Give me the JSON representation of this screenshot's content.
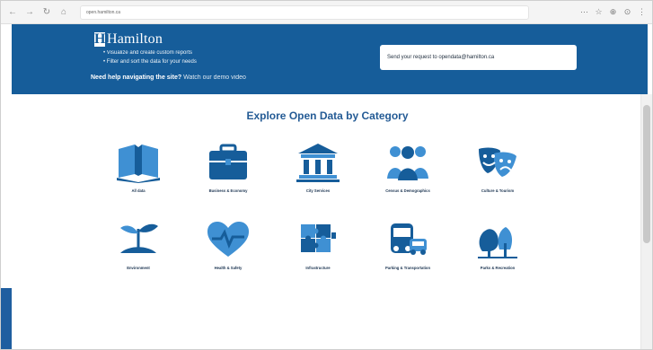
{
  "browser": {
    "url": "open.hamilton.ca"
  },
  "hero": {
    "logo": "Hamilton",
    "bullets": [
      "Visualize and create custom reports",
      "Filter and sort the data for your needs"
    ],
    "help_bold": "Need help navigating the site?",
    "help_link": "Watch our demo video",
    "request_text": "Send your request to opendata@hamilton.ca"
  },
  "main": {
    "title": "Explore Open Data by Category",
    "categories": [
      {
        "label": "All data",
        "icon": "book-icon"
      },
      {
        "label": "Business & Economy",
        "icon": "briefcase-icon"
      },
      {
        "label": "City Services",
        "icon": "building-columns-icon"
      },
      {
        "label": "Census & Demographics",
        "icon": "people-icon"
      },
      {
        "label": "Culture & Tourism",
        "icon": "theater-masks-icon"
      },
      {
        "label": "Environment",
        "icon": "sprout-icon"
      },
      {
        "label": "Health & Safety",
        "icon": "heart-pulse-icon"
      },
      {
        "label": "Infrastructure",
        "icon": "puzzle-icon"
      },
      {
        "label": "Parking & Transportation",
        "icon": "bus-car-icon"
      },
      {
        "label": "Parks & Recreation",
        "icon": "trees-icon"
      }
    ]
  },
  "colors": {
    "brand": "#165d9a",
    "title": "#245b95",
    "icon_dark": "#165d9a",
    "icon_light": "#3f90d3"
  }
}
